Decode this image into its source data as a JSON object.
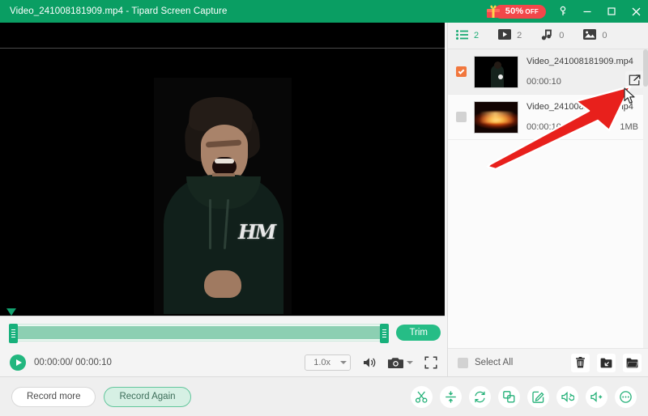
{
  "titlebar": {
    "file_name": "Video_241008181909.mp4",
    "separator": "-",
    "app_name": "Tipard Screen Capture",
    "title_full": "Video_241008181909.mp4  -  Tipard Screen Capture",
    "promo_percent": "50%",
    "promo_off": "OFF",
    "gift_icon": "gift-icon",
    "key_icon": "key-icon",
    "minimize_icon": "minimize-icon",
    "maximize_icon": "maximize-icon",
    "close_icon": "close-icon",
    "brand_color": "#0a9e63",
    "promo_color": "#f2474a"
  },
  "preview": {
    "description": "Video preview of a laughing person in a dark hoodie with HM logo on black background",
    "logo_text": "HM"
  },
  "timeline": {
    "trim_label": "Trim",
    "left_handle": "trim-start-handle",
    "right_handle": "trim-end-handle",
    "playhead": "playhead-marker"
  },
  "transport": {
    "play_icon": "play-icon",
    "current_time": "00:00:00/ 00:00:10",
    "speed_value": "1.0x",
    "volume_icon": "volume-icon",
    "snapshot_icon": "camera-icon",
    "snapshot_chevron": "chevron-down-icon",
    "fullscreen_icon": "fullscreen-icon"
  },
  "bottom": {
    "record_more": "Record more",
    "record_again": "Record Again",
    "tools": [
      {
        "name": "cut-icon",
        "title": "Cut"
      },
      {
        "name": "split-icon",
        "title": "Split"
      },
      {
        "name": "convert-icon",
        "title": "Convert"
      },
      {
        "name": "merge-icon",
        "title": "Merge"
      },
      {
        "name": "edit-icon",
        "title": "Edit"
      },
      {
        "name": "audio-extract-icon",
        "title": "Extract audio"
      },
      {
        "name": "volume-boost-icon",
        "title": "Volume"
      },
      {
        "name": "more-options-icon",
        "title": "More"
      }
    ]
  },
  "sidebar": {
    "tabs": [
      {
        "icon": "list-icon",
        "count": "2",
        "active": true
      },
      {
        "icon": "video-icon",
        "count": "2",
        "active": false
      },
      {
        "icon": "music-icon",
        "count": "0",
        "active": false
      },
      {
        "icon": "image-icon",
        "count": "0",
        "active": false
      }
    ],
    "files": [
      {
        "name": "Video_241008181909.mp4",
        "duration": "00:00:10",
        "size": "",
        "checked": true,
        "thumb": "person-thumb",
        "share_icon": "share-export-icon"
      },
      {
        "name": "Video_241008175250.mp4",
        "duration": "00:00:10",
        "size": "1MB",
        "checked": false,
        "thumb": "fire-thumb",
        "share_icon": ""
      }
    ],
    "footer": {
      "select_all_label": "Select All",
      "delete_icon": "trash-icon",
      "export_icon": "export-folder-icon",
      "open_folder_icon": "open-folder-icon"
    }
  },
  "annotation": {
    "arrow_color": "#e8201c",
    "arrow_name": "red-pointer-arrow",
    "cursor_name": "mouse-cursor"
  }
}
